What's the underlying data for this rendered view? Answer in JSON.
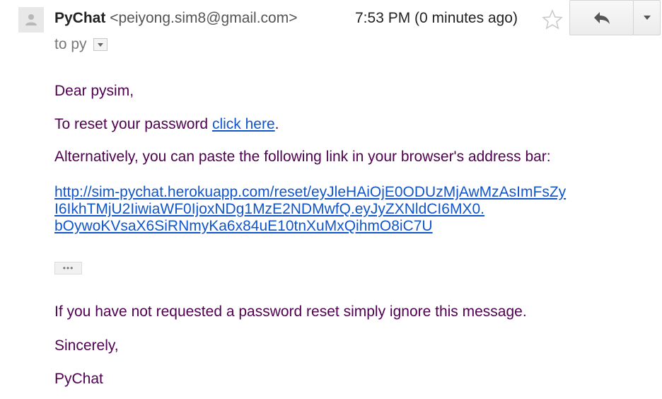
{
  "header": {
    "sender_name": "PyChat",
    "sender_email": "<peiyong.sim8@gmail.com>",
    "timestamp": "7:53 PM (0 minutes ago)",
    "recipient": "to py",
    "avatar_icon": "person-icon",
    "star_icon": "star-outline-icon",
    "reply_icon": "reply-arrow-icon",
    "more_icon": "caret-down-icon"
  },
  "message": {
    "greeting": "Dear pysim,",
    "reset_prefix": "To reset your password ",
    "reset_link_text": "click here",
    "reset_suffix": ".",
    "alternative_text": "Alternatively, you can paste the following link in your browser's address bar:",
    "reset_url_lines": [
      "http://sim-pychat.herokuapp.com/reset/eyJleHAiOjE0ODUzMjAwMzAsImFsZy",
      "I6IkhTMjU2IiwiaWF0IjoxNDg1MzE2NDMwfQ.eyJyZXNldCI6MX0.",
      "bOywoKVsaX6SiRNmyKa6x84uE10tnXuMxQihmO8iC7U"
    ],
    "trimmed_content_label": "•••",
    "ignore_text": "If you have not requested a password reset simply ignore this message.",
    "closing": "Sincerely,",
    "signature": "PyChat"
  },
  "colors": {
    "body_text": "#500050",
    "link": "#1155cc",
    "sender_name": "#222222",
    "muted": "#777777"
  }
}
